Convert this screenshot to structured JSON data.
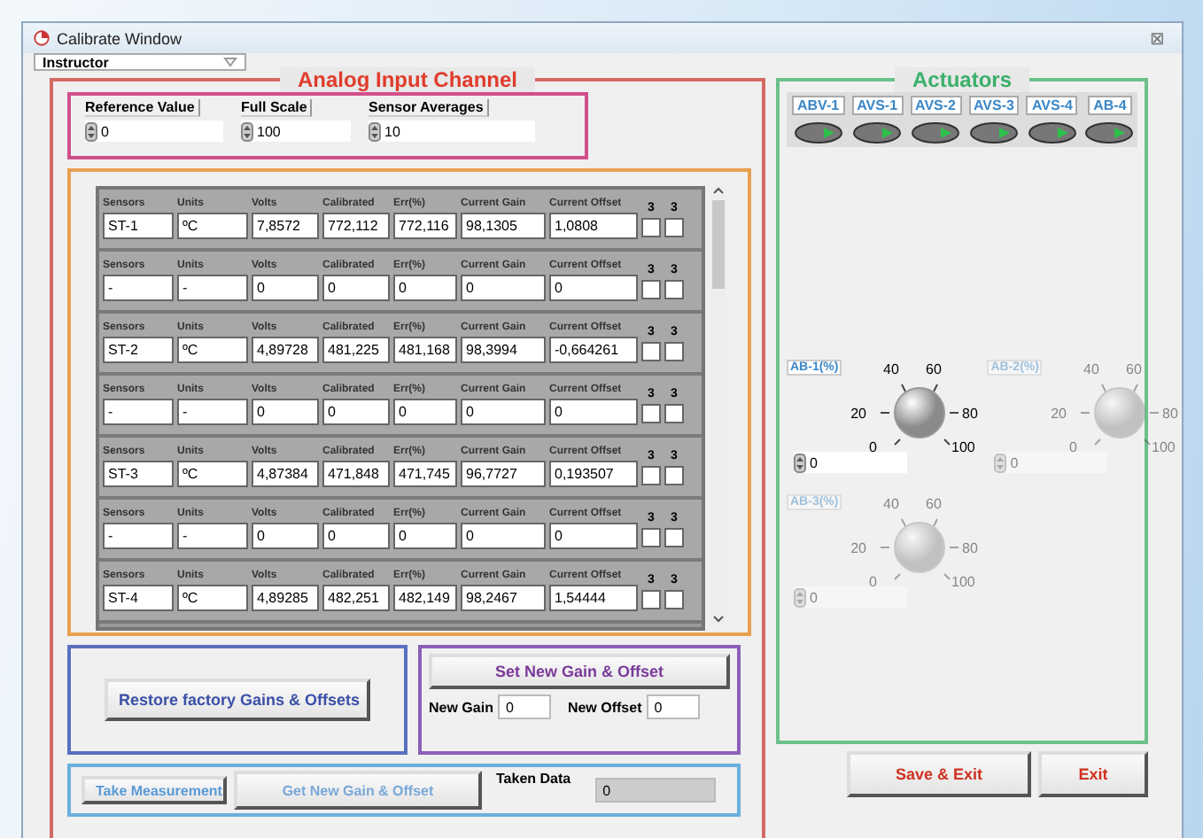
{
  "window": {
    "title": "Calibrate Window",
    "close": "⊠"
  },
  "user_menu": {
    "value": "Instructor"
  },
  "analog_panel": {
    "title": "Analog Input Channel",
    "settings": [
      {
        "label": "Reference Value",
        "value": "0"
      },
      {
        "label": "Full Scale",
        "value": "100"
      },
      {
        "label": "Sensor Averages",
        "value": "10"
      }
    ],
    "sensor_rows": [
      {
        "cells": [
          {
            "header": "Sensors",
            "value": "ST-1"
          },
          {
            "header": "Units",
            "value": "ºC"
          },
          {
            "header": "Volts",
            "value": "7,8572"
          },
          {
            "header": "Calibrated",
            "value": "772,112"
          },
          {
            "header": "Err(%)",
            "value": "772,116"
          },
          {
            "header": "Current Gain",
            "value": "98,1305"
          },
          {
            "header": "Current Offset",
            "value": "1,0808"
          }
        ],
        "flags": [
          {
            "label": "3",
            "checked": false
          },
          {
            "label": "3",
            "checked": false
          }
        ]
      },
      {
        "cells": [
          {
            "header": "Sensors",
            "value": "-"
          },
          {
            "header": "Units",
            "value": "-"
          },
          {
            "header": "Volts",
            "value": "0"
          },
          {
            "header": "Calibrated",
            "value": "0"
          },
          {
            "header": "Err(%)",
            "value": "0"
          },
          {
            "header": "Current Gain",
            "value": "0"
          },
          {
            "header": "Current Offset",
            "value": "0"
          }
        ],
        "flags": [
          {
            "label": "3",
            "checked": false
          },
          {
            "label": "3",
            "checked": false
          }
        ]
      },
      {
        "cells": [
          {
            "header": "Sensors",
            "value": "ST-2"
          },
          {
            "header": "Units",
            "value": "ºC"
          },
          {
            "header": "Volts",
            "value": "4,89728"
          },
          {
            "header": "Calibrated",
            "value": "481,225"
          },
          {
            "header": "Err(%)",
            "value": "481,168"
          },
          {
            "header": "Current Gain",
            "value": "98,3994"
          },
          {
            "header": "Current Offset",
            "value": "-0,664261"
          }
        ],
        "flags": [
          {
            "label": "3",
            "checked": false
          },
          {
            "label": "3",
            "checked": false
          }
        ]
      },
      {
        "cells": [
          {
            "header": "Sensors",
            "value": "-"
          },
          {
            "header": "Units",
            "value": "-"
          },
          {
            "header": "Volts",
            "value": "0"
          },
          {
            "header": "Calibrated",
            "value": "0"
          },
          {
            "header": "Err(%)",
            "value": "0"
          },
          {
            "header": "Current Gain",
            "value": "0"
          },
          {
            "header": "Current Offset",
            "value": "0"
          }
        ],
        "flags": [
          {
            "label": "3",
            "checked": false
          },
          {
            "label": "3",
            "checked": false
          }
        ]
      },
      {
        "cells": [
          {
            "header": "Sensors",
            "value": "ST-3"
          },
          {
            "header": "Units",
            "value": "ºC"
          },
          {
            "header": "Volts",
            "value": "4,87384"
          },
          {
            "header": "Calibrated",
            "value": "471,848"
          },
          {
            "header": "Err(%)",
            "value": "471,745"
          },
          {
            "header": "Current Gain",
            "value": "96,7727"
          },
          {
            "header": "Current Offset",
            "value": "0,193507"
          }
        ],
        "flags": [
          {
            "label": "3",
            "checked": false
          },
          {
            "label": "3",
            "checked": false
          }
        ]
      },
      {
        "cells": [
          {
            "header": "Sensors",
            "value": "-"
          },
          {
            "header": "Units",
            "value": "-"
          },
          {
            "header": "Volts",
            "value": "0"
          },
          {
            "header": "Calibrated",
            "value": "0"
          },
          {
            "header": "Err(%)",
            "value": "0"
          },
          {
            "header": "Current Gain",
            "value": "0"
          },
          {
            "header": "Current Offset",
            "value": "0"
          }
        ],
        "flags": [
          {
            "label": "3",
            "checked": false
          },
          {
            "label": "3",
            "checked": false
          }
        ]
      },
      {
        "cells": [
          {
            "header": "Sensors",
            "value": "ST-4"
          },
          {
            "header": "Units",
            "value": "ºC"
          },
          {
            "header": "Volts",
            "value": "4,89285"
          },
          {
            "header": "Calibrated",
            "value": "482,251"
          },
          {
            "header": "Err(%)",
            "value": "482,149"
          },
          {
            "header": "Current Gain",
            "value": "98,2467"
          },
          {
            "header": "Current Offset",
            "value": "1,54444"
          }
        ],
        "flags": [
          {
            "label": "3",
            "checked": false
          },
          {
            "label": "3",
            "checked": false
          }
        ]
      }
    ],
    "restore_button": "Restore factory Gains & Offsets",
    "set_group": {
      "button": "Set New Gain & Offset",
      "new_gain": {
        "label": "New Gain",
        "value": "0"
      },
      "new_offset": {
        "label": "New Offset",
        "value": "0"
      }
    },
    "measure": {
      "take_button": "Take Measurement",
      "get_button": "Get New Gain & Offset",
      "taken_label": "Taken Data",
      "taken_value": "0"
    }
  },
  "actuators": {
    "title": "Actuators",
    "switches": [
      {
        "label": "ABV-1",
        "on": false
      },
      {
        "label": "AVS-1",
        "on": false
      },
      {
        "label": "AVS-2",
        "on": false
      },
      {
        "label": "AVS-3",
        "on": false
      },
      {
        "label": "AVS-4",
        "on": false
      },
      {
        "label": "AB-4",
        "on": false
      }
    ],
    "knobs": [
      {
        "label": "AB-1(%)",
        "disabled": false,
        "value": "0",
        "scale": [
          "0",
          "20",
          "40",
          "60",
          "80",
          "100"
        ]
      },
      {
        "label": "AB-2(%)",
        "disabled": true,
        "value": "0",
        "scale": [
          "0",
          "20",
          "40",
          "60",
          "80",
          "100"
        ]
      },
      {
        "label": "AB-3(%)",
        "disabled": true,
        "value": "0",
        "scale": [
          "0",
          "20",
          "40",
          "60",
          "80",
          "100"
        ]
      }
    ]
  },
  "buttons": [
    {
      "label": "Save & Exit"
    },
    {
      "label": "Exit"
    }
  ]
}
